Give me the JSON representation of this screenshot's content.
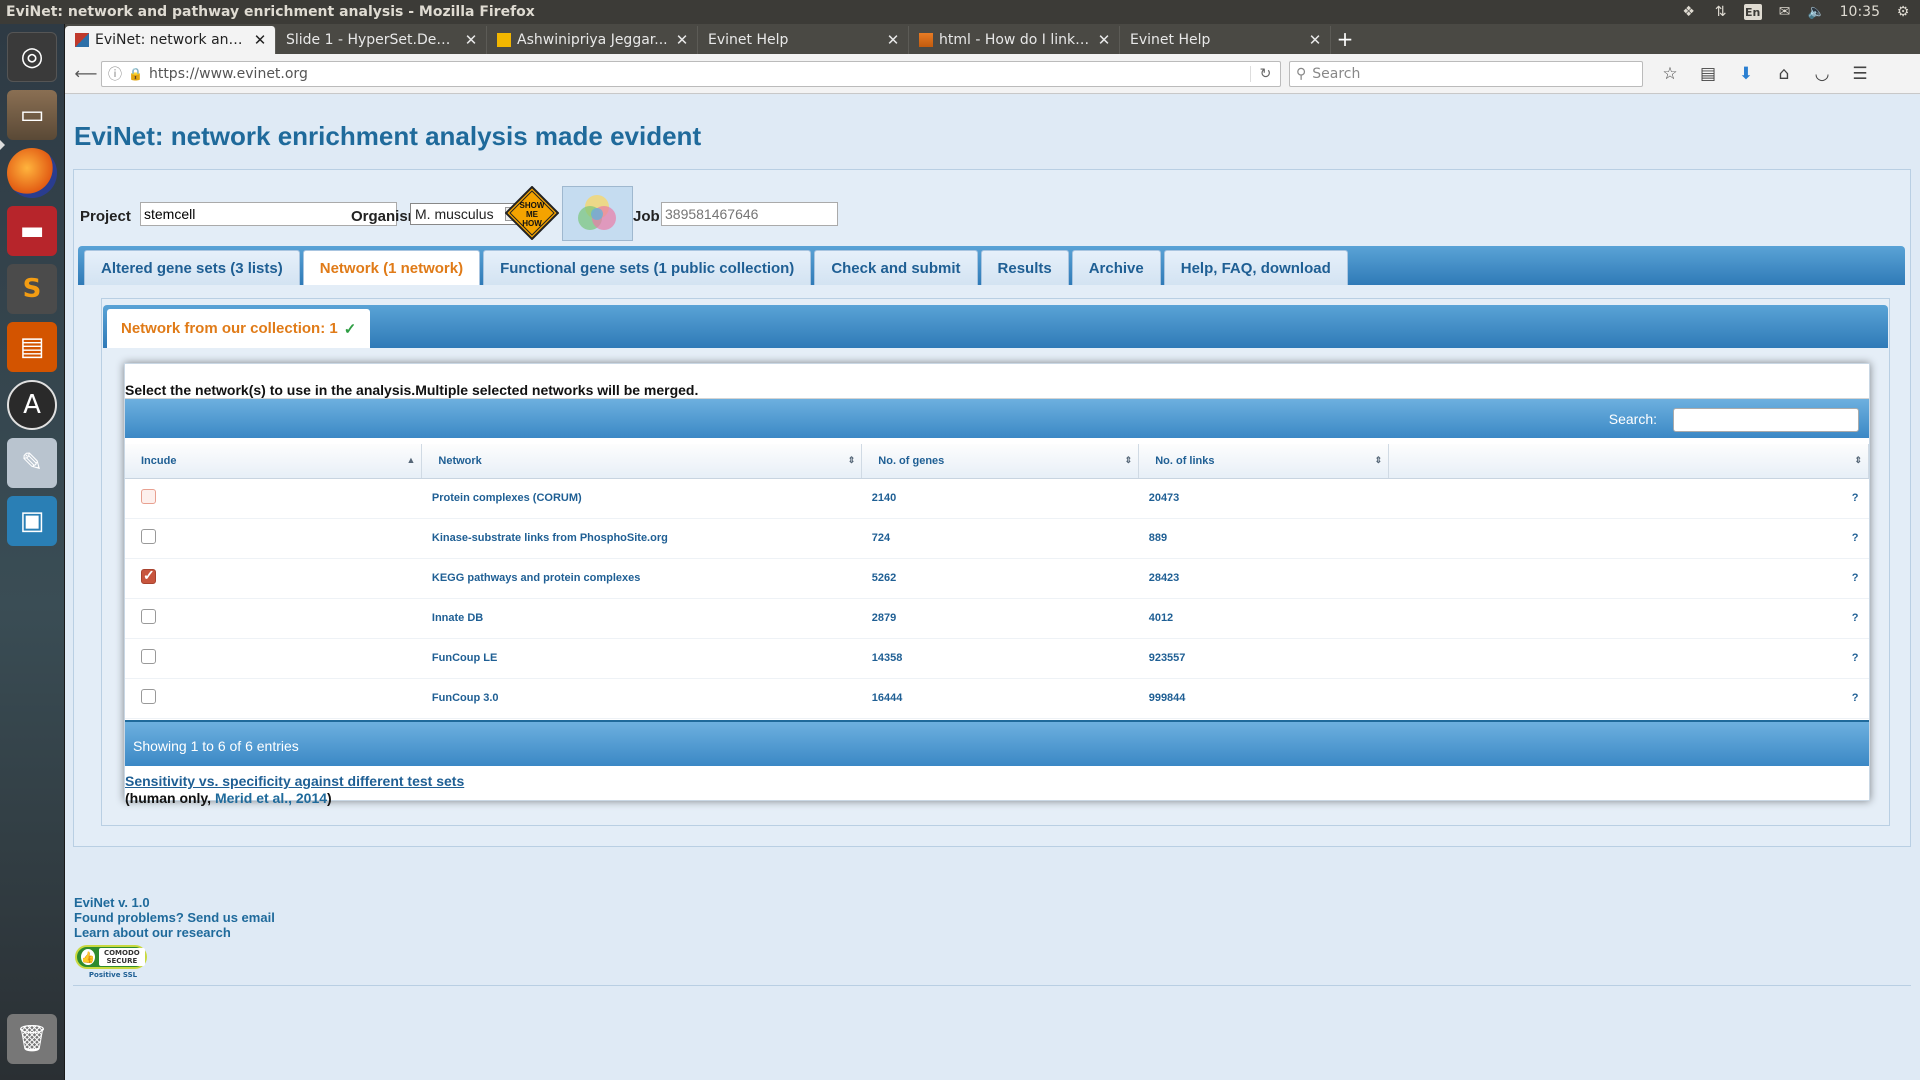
{
  "window": {
    "title": "EviNet: network and pathway enrichment analysis - Mozilla Firefox"
  },
  "system_tray": {
    "lang": "En",
    "time": "10:35"
  },
  "tabs": [
    {
      "title": "EviNet: network and...",
      "active": true
    },
    {
      "title": "Slide 1 - HyperSet.Dem...",
      "active": false
    },
    {
      "title": "Ashwinipriya Jeggar...",
      "active": false
    },
    {
      "title": "Evinet Help",
      "active": false
    },
    {
      "title": "html - How do I link t...",
      "active": false
    },
    {
      "title": "Evinet Help",
      "active": false
    }
  ],
  "navbar": {
    "url": "https://www.evinet.org",
    "search_placeholder": "Search"
  },
  "page": {
    "title": "EviNet: network enrichment analysis made evident",
    "form": {
      "project_label": "Project",
      "project_value": "stemcell",
      "organism_label": "Organism",
      "organism_value": "M. musculus",
      "show_me_how": "SHOW ME HOW",
      "job_label": "Job",
      "job_placeholder": "389581467646"
    },
    "main_tabs": [
      {
        "label": "Altered gene sets (3 lists)",
        "active": false
      },
      {
        "label": "Network (1 network)",
        "active": true
      },
      {
        "label": "Functional gene sets (1 public collection)",
        "active": false
      },
      {
        "label": "Check and submit",
        "active": false
      },
      {
        "label": "Results",
        "active": false
      },
      {
        "label": "Archive",
        "active": false
      },
      {
        "label": "Help, FAQ, download",
        "active": false
      }
    ],
    "sub_tab": {
      "label": "Network from our collection: 1",
      "check": "✓"
    },
    "instruction": "Select the network(s) to use in the analysis.Multiple selected networks will be merged.",
    "table": {
      "search_label": "Search:",
      "columns": [
        "Incude",
        "Network",
        "No. of genes",
        "No. of links",
        ""
      ],
      "rows": [
        {
          "network": "Protein complexes (CORUM)",
          "genes": "2140",
          "links": "20473",
          "checked": false,
          "help": "?"
        },
        {
          "network": "Kinase-substrate links from PhosphoSite.org",
          "genes": "724",
          "links": "889",
          "checked": false,
          "help": "?"
        },
        {
          "network": "KEGG pathways and protein complexes",
          "genes": "5262",
          "links": "28423",
          "checked": true,
          "help": "?"
        },
        {
          "network": "Innate DB",
          "genes": "2879",
          "links": "4012",
          "checked": false,
          "help": "?"
        },
        {
          "network": "FunCoup LE",
          "genes": "14358",
          "links": "923557",
          "checked": false,
          "help": "?"
        },
        {
          "network": "FunCoup 3.0",
          "genes": "16444",
          "links": "999844",
          "checked": false,
          "help": "?"
        }
      ],
      "info": "Showing 1 to 6 of 6 entries"
    },
    "sens_link": "Sensitivity vs. specificity against different test sets",
    "human_note_prefix": "(human only, ",
    "human_note_link": "Merid et al., 2014",
    "human_note_suffix": ")",
    "footer": {
      "version": "EviNet v. 1.0",
      "problems": "Found problems? Send us email",
      "research": "Learn about our research",
      "comodo_top": "COMODO SECURE",
      "comodo_ssl": "Positive SSL"
    }
  },
  "colors": {
    "accent": "#1f6a9b",
    "active_tab": "#e07b18",
    "bar": "#3b88c5"
  }
}
